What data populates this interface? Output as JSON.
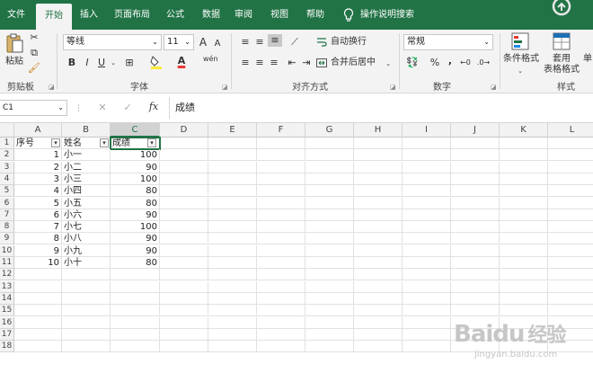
{
  "tabs": [
    "文件",
    "开始",
    "插入",
    "页面布局",
    "公式",
    "数据",
    "审阅",
    "视图",
    "帮助"
  ],
  "tell_me": "操作说明搜索",
  "ribbon": {
    "clipboard": {
      "paste": "粘贴",
      "label": "剪贴板"
    },
    "font": {
      "name": "等线",
      "size": "11",
      "grow": "A",
      "shrink": "A",
      "bold": "B",
      "italic": "I",
      "underline": "U",
      "label": "字体",
      "font_color": "A",
      "wen": "wén"
    },
    "alignment": {
      "wrap": "自动换行",
      "merge": "合并后居中",
      "label": "对齐方式"
    },
    "number": {
      "format": "常规",
      "percent": "%",
      "comma": ",",
      "label": "数字"
    },
    "styles": {
      "conditional": "条件格式",
      "table_line1": "套用",
      "table_line2": "表格格式",
      "cell_styles": "单",
      "label": "样式"
    }
  },
  "formula_bar": {
    "name_box": "C1",
    "fx": "fx",
    "content": "成绩"
  },
  "columns": [
    "A",
    "B",
    "C",
    "D",
    "E",
    "F",
    "G",
    "H",
    "I",
    "J",
    "K",
    "L"
  ],
  "rows": [
    "1",
    "2",
    "3",
    "4",
    "5",
    "6",
    "7",
    "8",
    "9",
    "10",
    "11",
    "12",
    "13",
    "14",
    "15",
    "16",
    "17",
    "18"
  ],
  "headers": [
    "序号",
    "姓名",
    "成绩"
  ],
  "table": [
    {
      "id": "1",
      "name": "小一",
      "score": "100"
    },
    {
      "id": "2",
      "name": "小二",
      "score": "90"
    },
    {
      "id": "3",
      "name": "小三",
      "score": "100"
    },
    {
      "id": "4",
      "name": "小四",
      "score": "80"
    },
    {
      "id": "5",
      "name": "小五",
      "score": "80"
    },
    {
      "id": "6",
      "name": "小六",
      "score": "90"
    },
    {
      "id": "7",
      "name": "小七",
      "score": "100"
    },
    {
      "id": "8",
      "name": "小八",
      "score": "90"
    },
    {
      "id": "9",
      "name": "小九",
      "score": "90"
    },
    {
      "id": "10",
      "name": "小十",
      "score": "80"
    }
  ],
  "watermark": {
    "brand": "Baidu",
    "cn": "经验",
    "url": "jingyan.baidu.com"
  },
  "colors": {
    "excel_green": "#217346"
  }
}
